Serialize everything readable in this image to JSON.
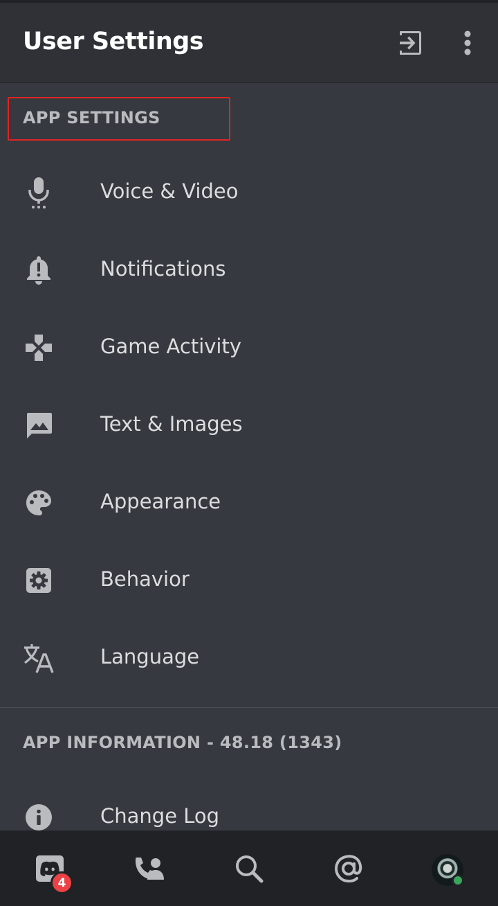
{
  "header": {
    "title": "User Settings",
    "logout_icon": "logout-icon",
    "more_icon": "more-vertical-icon"
  },
  "app_settings": {
    "heading": "APP SETTINGS",
    "items": [
      {
        "label": "Voice & Video",
        "icon": "microphone-icon"
      },
      {
        "label": "Notifications",
        "icon": "bell-icon"
      },
      {
        "label": "Game Activity",
        "icon": "gamepad-icon"
      },
      {
        "label": "Text & Images",
        "icon": "image-icon"
      },
      {
        "label": "Appearance",
        "icon": "palette-icon"
      },
      {
        "label": "Behavior",
        "icon": "gear-icon"
      },
      {
        "label": "Language",
        "icon": "translate-icon"
      }
    ]
  },
  "app_information": {
    "heading": "APP INFORMATION - 48.18 (1343)",
    "items": [
      {
        "label": "Change Log",
        "icon": "info-icon"
      }
    ]
  },
  "bottom_nav": {
    "home_badge": "4",
    "items": [
      "discord-home-icon",
      "friends-icon",
      "search-icon",
      "mentions-icon",
      "user-avatar"
    ]
  },
  "colors": {
    "background": "#36393f",
    "header": "#2f3136",
    "nav": "#202225",
    "highlight": "#e02424",
    "badge": "#ed4245",
    "online": "#3ba55d"
  }
}
